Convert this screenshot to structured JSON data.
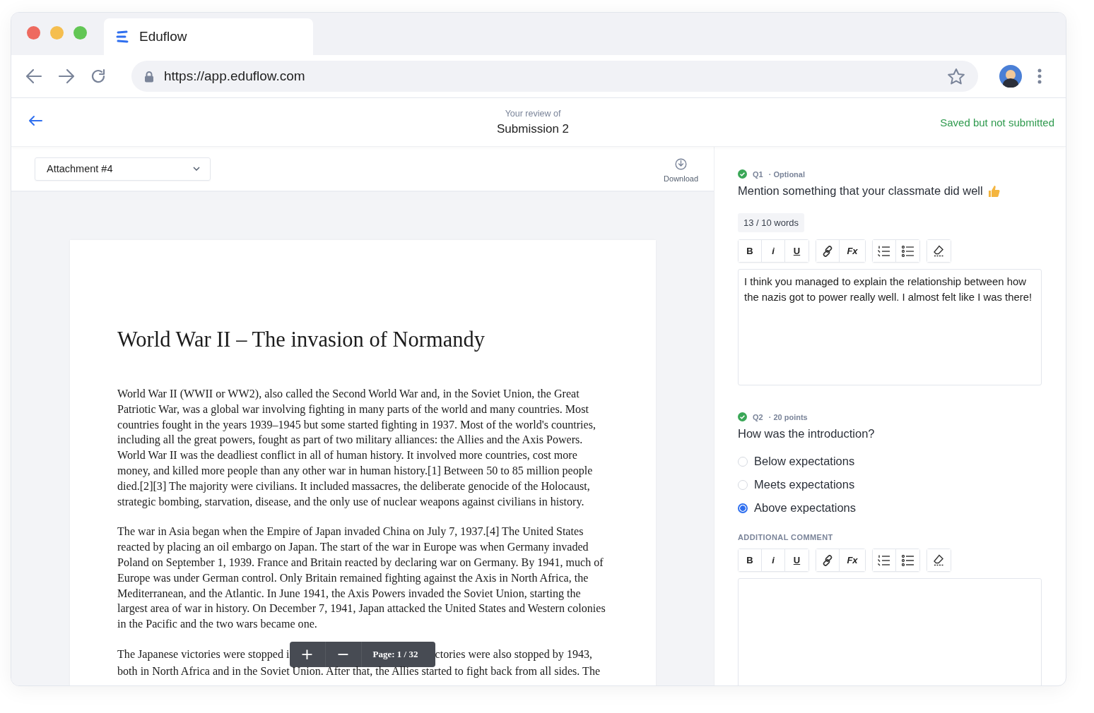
{
  "browser": {
    "tab_title": "Eduflow",
    "url": "https://app.eduflow.com"
  },
  "header": {
    "subtitle": "Your review of",
    "title": "Submission 2",
    "status": "Saved but not submitted"
  },
  "viewer": {
    "attachment": "Attachment #4",
    "download": "Download",
    "document": {
      "title": "World War II – The invasion of Normandy",
      "paragraphs": [
        "World War II (WWII or WW2), also called the Second World War and, in the Soviet Union, the Great Patriotic War, was a global war involving fighting in many parts of the world and many countries. Most countries fought in the years 1939–1945 but some started fighting in 1937. Most of the world's countries, including all the great powers, fought as part of two military alliances: the Allies and the Axis Powers. World War II was the deadliest conflict in all of human history. It involved more countries, cost more money, and killed more people than any other war in human history.[1] Between 50 to 85 million people died.[2][3] The majority were civilians. It included massacres, the deliberate genocide of the Holocaust, strategic bombing, starvation, disease, and the only use of nuclear weapons against civilians in history.",
        "The war in Asia began when the Empire of Japan invaded China on July 7, 1937.[4] The United States reacted by placing an oil embargo on Japan. The start of the war in Europe was when Germany invaded Poland on September 1, 1939. France and Britain reacted by declaring war on Germany. By 1941, much of Europe was under German control. Only Britain remained fighting against the Axis in North Africa, the Mediterranean, and the Atlantic. In June 1941, the Axis Powers invaded the Soviet Union, starting the largest area of war in history. On December 7, 1941, Japan attacked the United States and Western colonies in the Pacific and the two wars became one.",
        "The Japanese victories were stopped i"
      ],
      "after_pager": "ctories were also stopped by 1943,",
      "last_line": "both in North Africa and in the Soviet Union. After that, the Allies started to fight back from all sides. The"
    },
    "pager": {
      "zoom_in": "+",
      "zoom_out": "−",
      "page": "Page: 1 / 32"
    }
  },
  "questions": [
    {
      "kind": "text",
      "number": "Q1",
      "meta": "· Optional",
      "answered": true,
      "prompt": "Mention something that your classmate did well",
      "word_count": "13 / 10 words",
      "toolbar": {
        "bold": "B",
        "italic": "i",
        "underline": "U",
        "clear": "Fx"
      },
      "answer": "I think you managed to explain the relationship between how the nazis got to power really well. I almost felt like I was there!"
    },
    {
      "kind": "choice",
      "number": "Q2",
      "meta": "· 20 points",
      "answered": true,
      "prompt": "How was the introduction?",
      "options": [
        {
          "label": "Below expectations",
          "selected": false
        },
        {
          "label": "Meets expectations",
          "selected": false
        },
        {
          "label": "Above expectations",
          "selected": true
        }
      ],
      "comment_label": "ADDITIONAL COMMENT",
      "toolbar": {
        "bold": "B",
        "italic": "i",
        "underline": "U",
        "clear": "Fx"
      }
    }
  ]
}
